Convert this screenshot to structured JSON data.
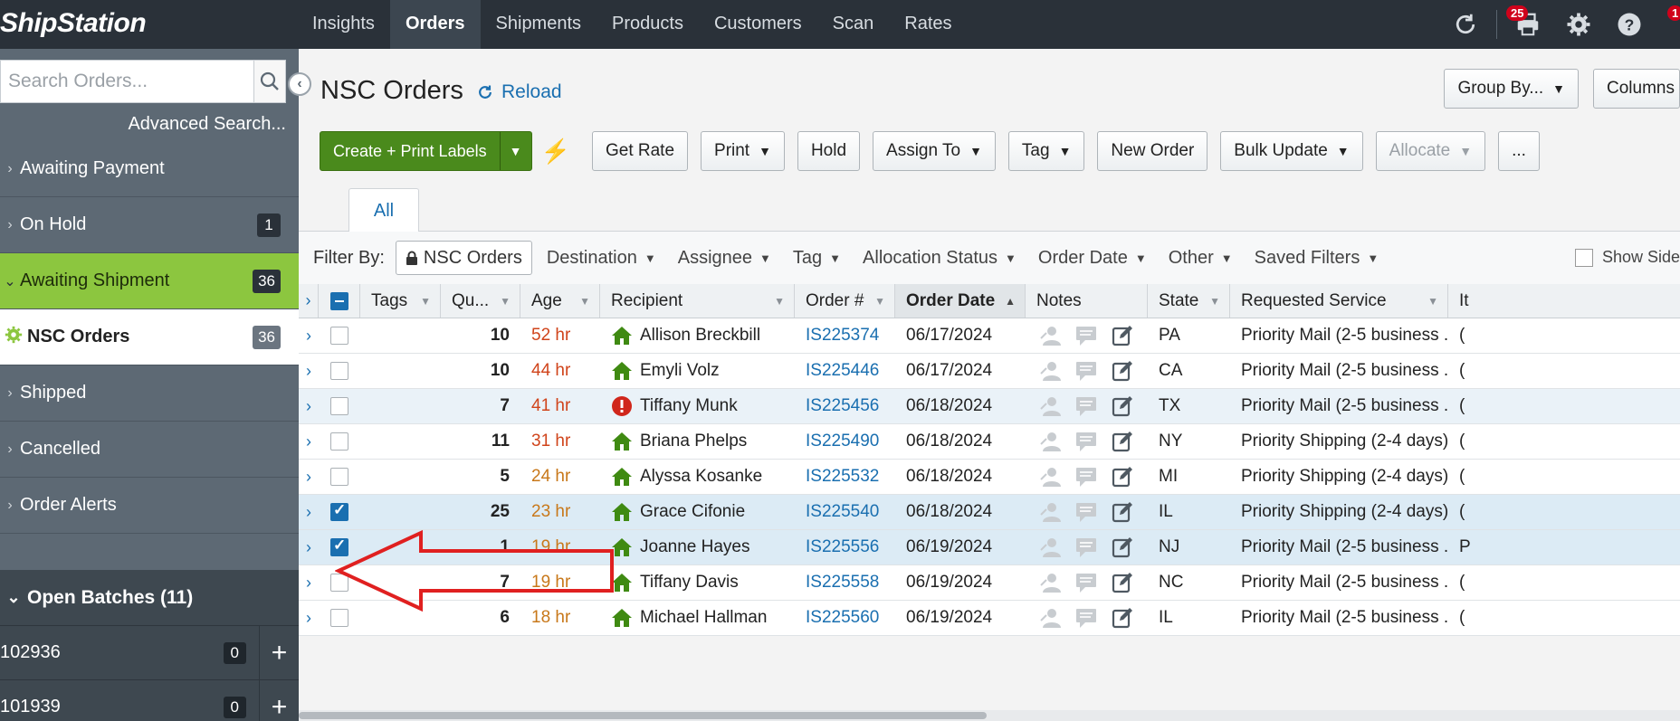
{
  "app": {
    "logo_text": "ShipStation",
    "nav": [
      "Insights",
      "Orders",
      "Shipments",
      "Products",
      "Customers",
      "Scan",
      "Rates"
    ],
    "active_nav": "Orders",
    "print_badge": "25",
    "notif_badge": "1"
  },
  "sidebar": {
    "search_placeholder": "Search Orders...",
    "advanced_search": "Advanced Search...",
    "items": [
      {
        "label": "Awaiting Payment",
        "count": ""
      },
      {
        "label": "On Hold",
        "count": "1"
      },
      {
        "label": "Awaiting Shipment",
        "count": "36"
      },
      {
        "label": "NSC Orders",
        "count": "36"
      },
      {
        "label": "Shipped",
        "count": ""
      },
      {
        "label": "Cancelled",
        "count": ""
      },
      {
        "label": "Order Alerts",
        "count": ""
      }
    ],
    "open_batches": "Open Batches (11)",
    "batches": [
      {
        "name": "102936",
        "count": "0"
      },
      {
        "name": "101939",
        "count": "0"
      }
    ]
  },
  "main": {
    "title": "NSC Orders",
    "reload": "Reload",
    "group_by": "Group By...",
    "columns": "Columns",
    "toolbar": {
      "create_print": "Create + Print Labels",
      "get_rate": "Get Rate",
      "print": "Print",
      "hold": "Hold",
      "assign_to": "Assign To",
      "tag": "Tag",
      "new_order": "New Order",
      "bulk_update": "Bulk Update",
      "allocate": "Allocate",
      "more": "..."
    },
    "tab_all": "All",
    "filter": {
      "label": "Filter By:",
      "chip": "NSC Orders",
      "dropdowns": [
        "Destination",
        "Assignee",
        "Tag",
        "Allocation Status",
        "Order Date",
        "Other",
        "Saved Filters"
      ],
      "show_sidebar": "Show Side"
    },
    "columns_header": {
      "tags": "Tags",
      "qty": "Qu...",
      "age": "Age",
      "recipient": "Recipient",
      "order_no": "Order #",
      "order_date": "Order Date",
      "notes": "Notes",
      "state": "State",
      "service": "Requested Service",
      "extra": "It"
    },
    "rows": [
      {
        "qty": "10",
        "age": "52 hr",
        "age_level": "red",
        "recipient": "Allison Breckbill",
        "icon": "home",
        "order": "IS225374",
        "date": "06/17/2024",
        "state": "PA",
        "service": "Priority Mail (2-5 business ...",
        "extra": "(",
        "checked": false,
        "style": ""
      },
      {
        "qty": "10",
        "age": "44 hr",
        "age_level": "red",
        "recipient": "Emyli Volz",
        "icon": "home",
        "order": "IS225446",
        "date": "06/17/2024",
        "state": "CA",
        "service": "Priority Mail (2-5 business ...",
        "extra": "(",
        "checked": false,
        "style": ""
      },
      {
        "qty": "7",
        "age": "41 hr",
        "age_level": "red",
        "recipient": "Tiffany Munk",
        "icon": "alert",
        "order": "IS225456",
        "date": "06/18/2024",
        "state": "TX",
        "service": "Priority Mail (2-5 business ...",
        "extra": "(",
        "checked": false,
        "style": "alt"
      },
      {
        "qty": "11",
        "age": "31 hr",
        "age_level": "red",
        "recipient": "Briana Phelps",
        "icon": "home",
        "order": "IS225490",
        "date": "06/18/2024",
        "state": "NY",
        "service": "Priority Shipping (2-4 days)",
        "extra": "(",
        "checked": false,
        "style": ""
      },
      {
        "qty": "5",
        "age": "24 hr",
        "age_level": "orange",
        "recipient": "Alyssa Kosanke",
        "icon": "home",
        "order": "IS225532",
        "date": "06/18/2024",
        "state": "MI",
        "service": "Priority Shipping (2-4 days)",
        "extra": "(",
        "checked": false,
        "style": ""
      },
      {
        "qty": "25",
        "age": "23 hr",
        "age_level": "orange",
        "recipient": "Grace Cifonie",
        "icon": "home",
        "order": "IS225540",
        "date": "06/18/2024",
        "state": "IL",
        "service": "Priority Shipping (2-4 days)",
        "extra": "(",
        "checked": true,
        "style": "sel"
      },
      {
        "qty": "1",
        "age": "19 hr",
        "age_level": "orange",
        "recipient": "Joanne Hayes",
        "icon": "home",
        "order": "IS225556",
        "date": "06/19/2024",
        "state": "NJ",
        "service": "Priority Mail (2-5 business ...",
        "extra": "P",
        "checked": true,
        "style": "sel"
      },
      {
        "qty": "7",
        "age": "19 hr",
        "age_level": "orange",
        "recipient": "Tiffany Davis",
        "icon": "home",
        "order": "IS225558",
        "date": "06/19/2024",
        "state": "NC",
        "service": "Priority Mail (2-5 business ...",
        "extra": "(",
        "checked": false,
        "style": ""
      },
      {
        "qty": "6",
        "age": "18 hr",
        "age_level": "orange",
        "recipient": "Michael Hallman",
        "icon": "home",
        "order": "IS225560",
        "date": "06/19/2024",
        "state": "IL",
        "service": "Priority Mail (2-5 business ...",
        "extra": "(",
        "checked": false,
        "style": ""
      }
    ]
  },
  "colors": {
    "accent": "#1a6fb0",
    "green": "#8cc63f",
    "button_green": "#4a8a1c",
    "annotation_arrow": "#e02020"
  }
}
